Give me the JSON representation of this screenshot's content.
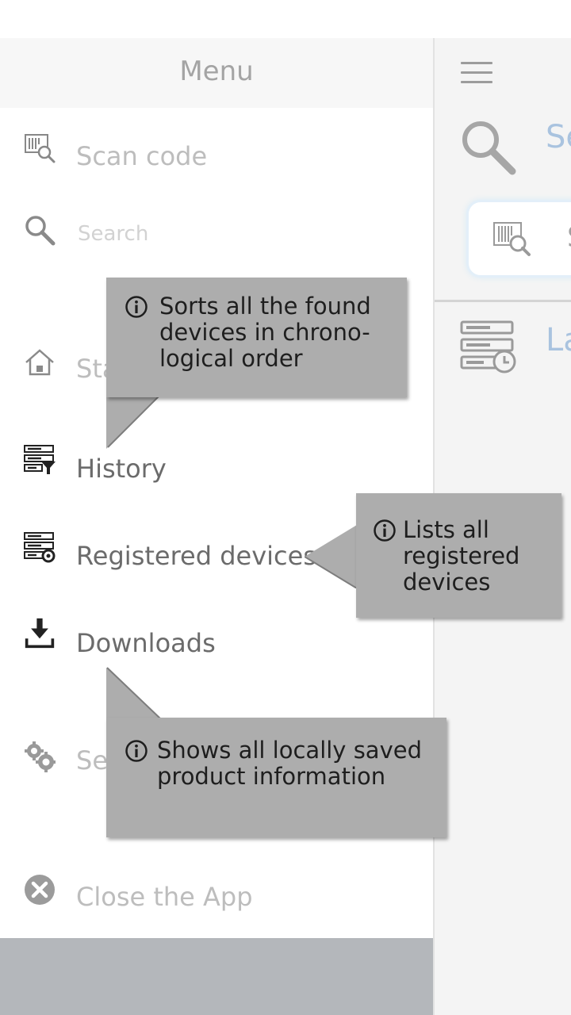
{
  "drawer": {
    "title": "Menu",
    "items": {
      "scan": {
        "label": "Scan code",
        "icon": "barcode-scan-icon"
      },
      "search": {
        "placeholder": "Search",
        "icon": "search-icon"
      },
      "start": {
        "label": "Sta",
        "icon": "home-icon"
      },
      "history": {
        "label": "History",
        "icon": "history-filter-icon"
      },
      "registered": {
        "label": "Registered devices",
        "icon": "registered-devices-icon"
      },
      "downloads": {
        "label": "Downloads",
        "icon": "download-icon"
      },
      "settings": {
        "label": "Se",
        "icon": "gear-icon"
      },
      "close": {
        "label": "Close the App",
        "icon": "close-circle-icon"
      }
    }
  },
  "main": {
    "search_label": "Se",
    "scan_box_text": "S",
    "last_label": "La"
  },
  "tooltips": {
    "history": "Sorts all the found devices in chrono-logical order",
    "registered": "Lists all registered devices",
    "downloads": "Shows all locally saved product information"
  },
  "colors": {
    "tooltip_bg": "#adadad",
    "accent_light_blue": "#a9c3df",
    "footer_gray": "#b4b7bb"
  }
}
